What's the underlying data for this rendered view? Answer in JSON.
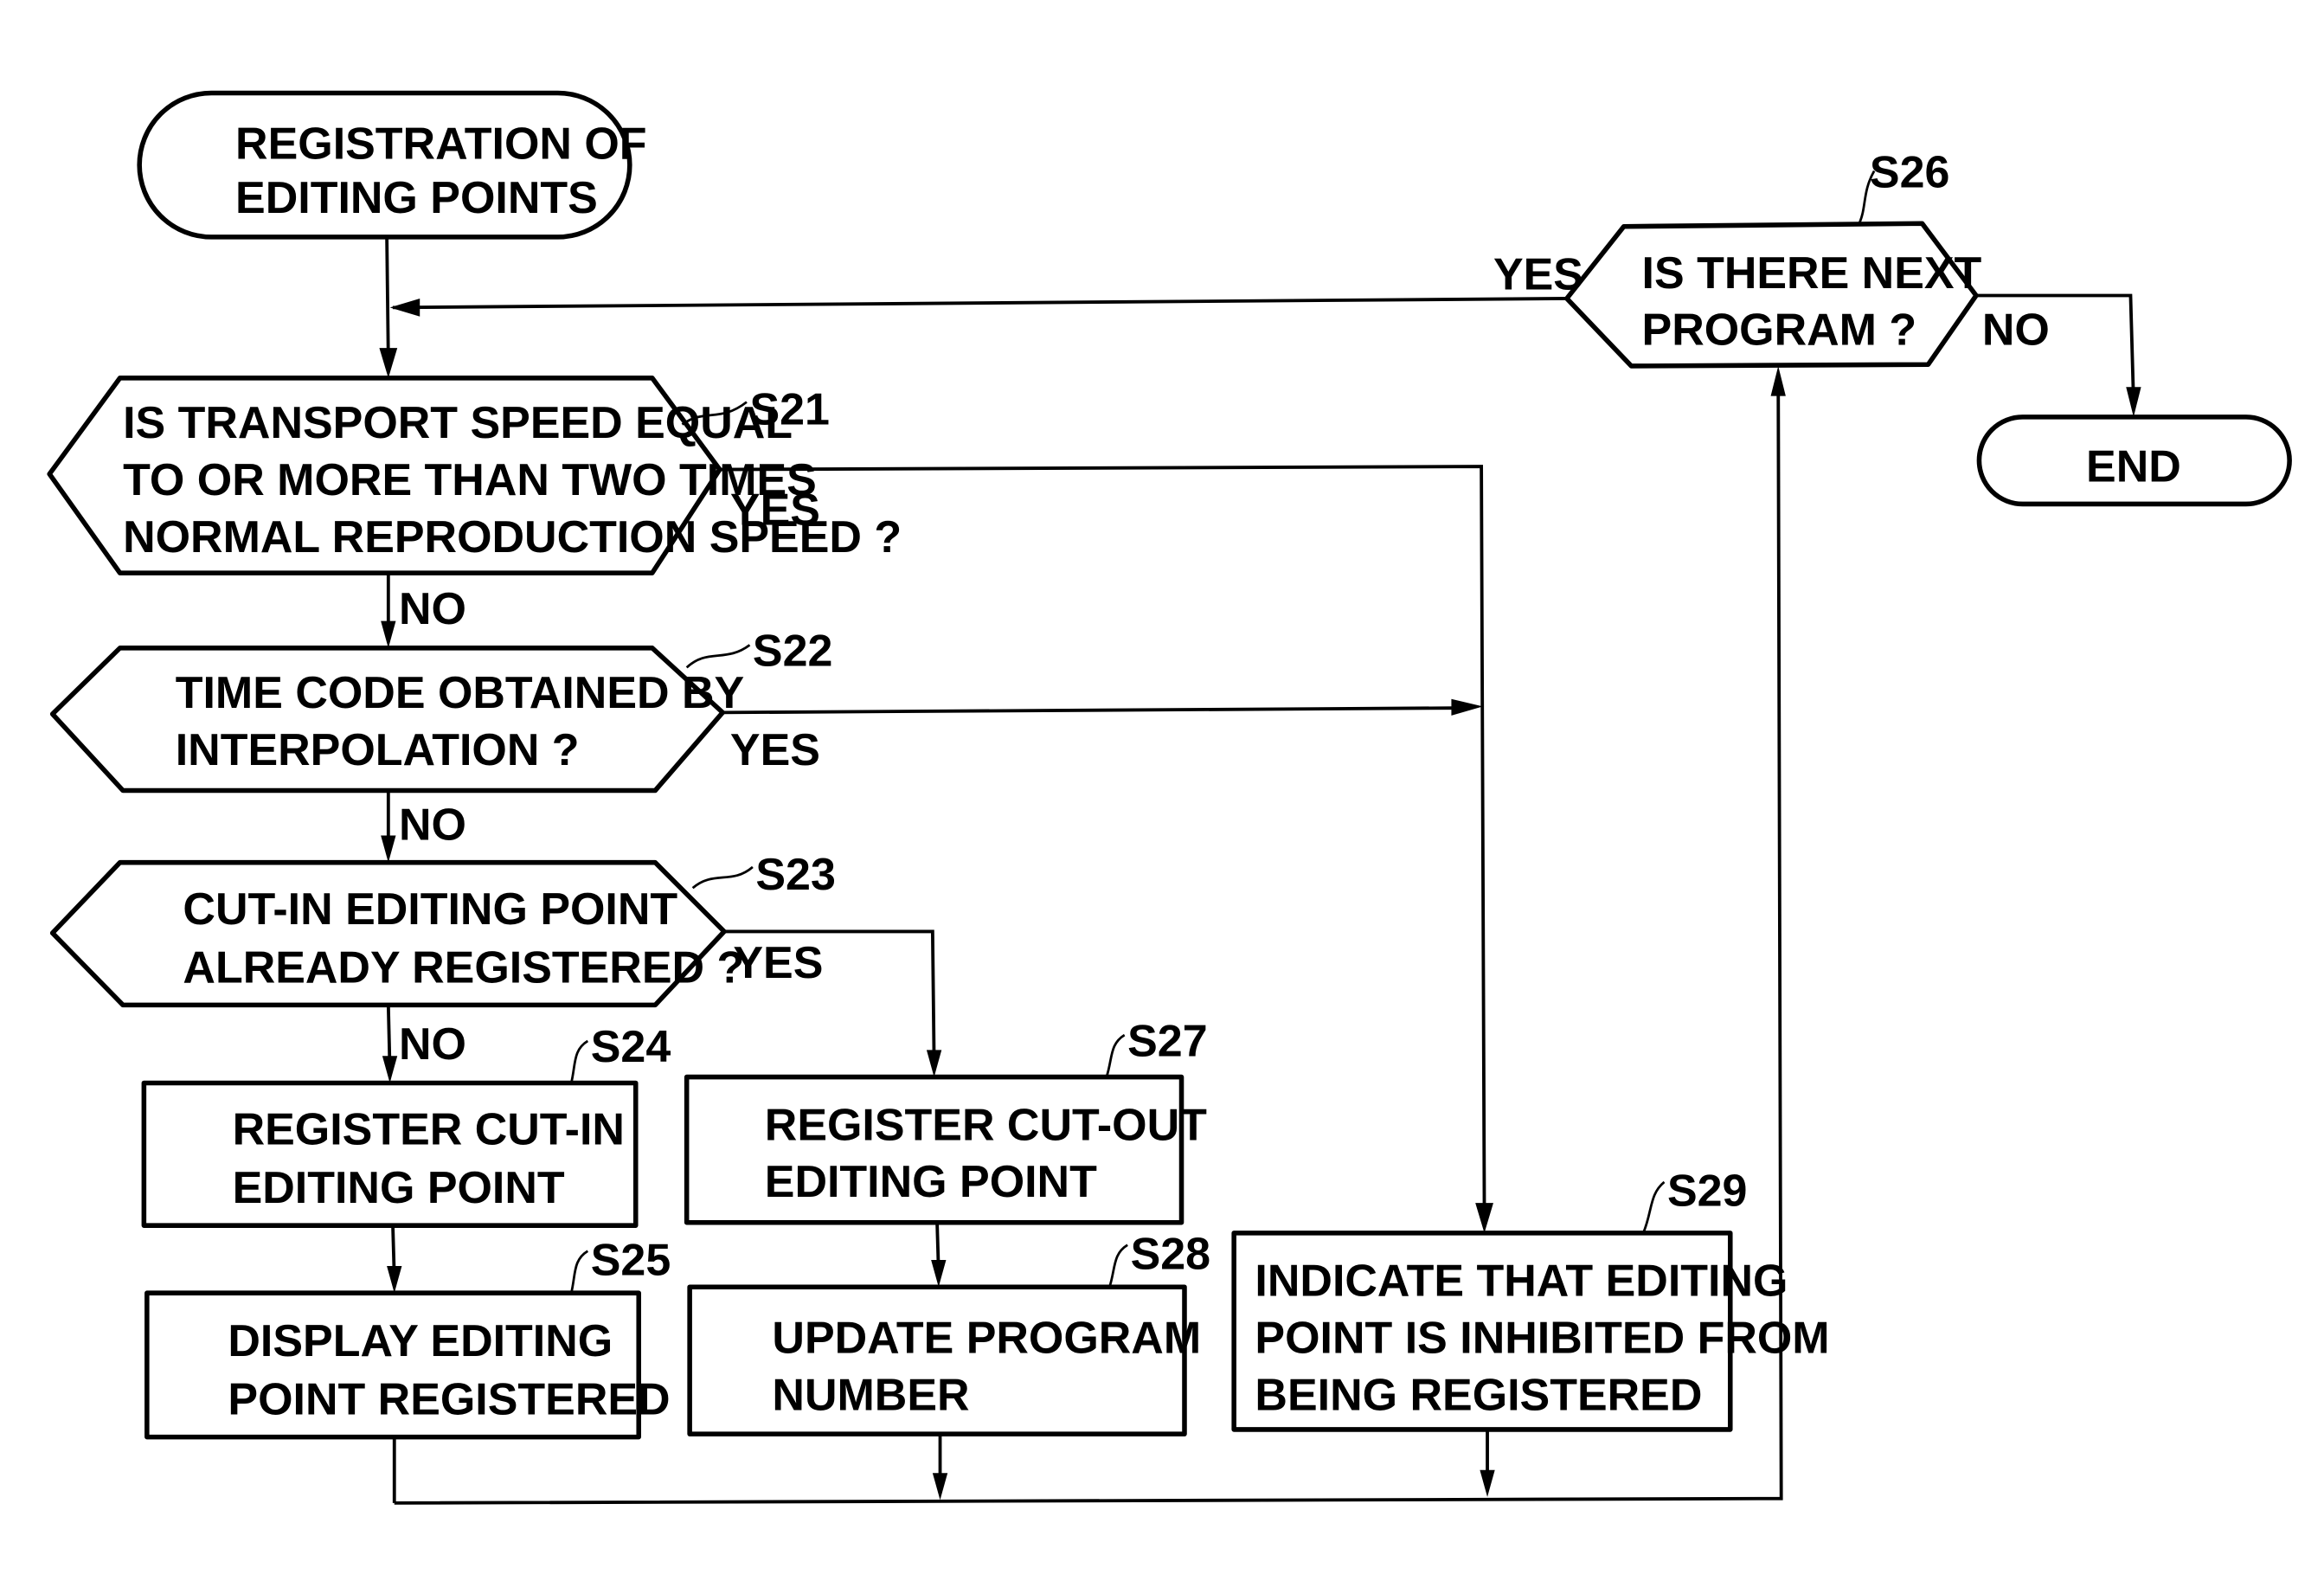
{
  "diagram": {
    "type": "flowchart",
    "start": {
      "lines": [
        "REGISTRATION OF",
        "EDITING POINTS"
      ]
    },
    "end": {
      "lines": [
        "END"
      ]
    },
    "steps": {
      "s21": {
        "id": "S21",
        "kind": "decision",
        "lines": [
          "IS TRANSPORT SPEED EQUAL",
          "TO OR MORE THAN TWO TIMES",
          "NORMAL REPRODUCTION SPEED ?"
        ],
        "yes": "YES",
        "no": "NO"
      },
      "s22": {
        "id": "S22",
        "kind": "decision",
        "lines": [
          "TIME CODE OBTAINED BY",
          "INTERPOLATION ?"
        ],
        "yes": "YES",
        "no": "NO"
      },
      "s23": {
        "id": "S23",
        "kind": "decision",
        "lines": [
          "CUT-IN EDITING POINT",
          "ALREADY REGISTERED ?"
        ],
        "yes": "YES",
        "no": "NO"
      },
      "s24": {
        "id": "S24",
        "kind": "process",
        "lines": [
          "REGISTER CUT-IN",
          "EDITING POINT"
        ]
      },
      "s25": {
        "id": "S25",
        "kind": "process",
        "lines": [
          "DISPLAY EDITING",
          "POINT REGISTERED"
        ]
      },
      "s26": {
        "id": "S26",
        "kind": "decision",
        "lines": [
          "IS THERE NEXT",
          "PROGRAM ?"
        ],
        "yes": "YES",
        "no": "NO"
      },
      "s27": {
        "id": "S27",
        "kind": "process",
        "lines": [
          "REGISTER CUT-OUT",
          "EDITING POINT"
        ]
      },
      "s28": {
        "id": "S28",
        "kind": "process",
        "lines": [
          "UPDATE PROGRAM",
          "NUMBER"
        ]
      },
      "s29": {
        "id": "S29",
        "kind": "process",
        "lines": [
          "INDICATE THAT EDITING",
          "POINT IS INHIBITED FROM",
          "BEING REGISTERED"
        ]
      }
    },
    "edges": [
      {
        "from": "start",
        "to": "S21"
      },
      {
        "from": "S21",
        "to": "S22",
        "label": "NO"
      },
      {
        "from": "S21",
        "to": "S29",
        "label": "YES"
      },
      {
        "from": "S22",
        "to": "S23",
        "label": "NO"
      },
      {
        "from": "S22",
        "to": "S29",
        "label": "YES"
      },
      {
        "from": "S23",
        "to": "S24",
        "label": "NO"
      },
      {
        "from": "S23",
        "to": "S27",
        "label": "YES"
      },
      {
        "from": "S24",
        "to": "S25"
      },
      {
        "from": "S27",
        "to": "S28"
      },
      {
        "from": "S25",
        "to": "S26"
      },
      {
        "from": "S28",
        "to": "S26"
      },
      {
        "from": "S29",
        "to": "S26"
      },
      {
        "from": "S26",
        "to": "S21",
        "label": "YES"
      },
      {
        "from": "S26",
        "to": "end",
        "label": "NO"
      }
    ]
  }
}
